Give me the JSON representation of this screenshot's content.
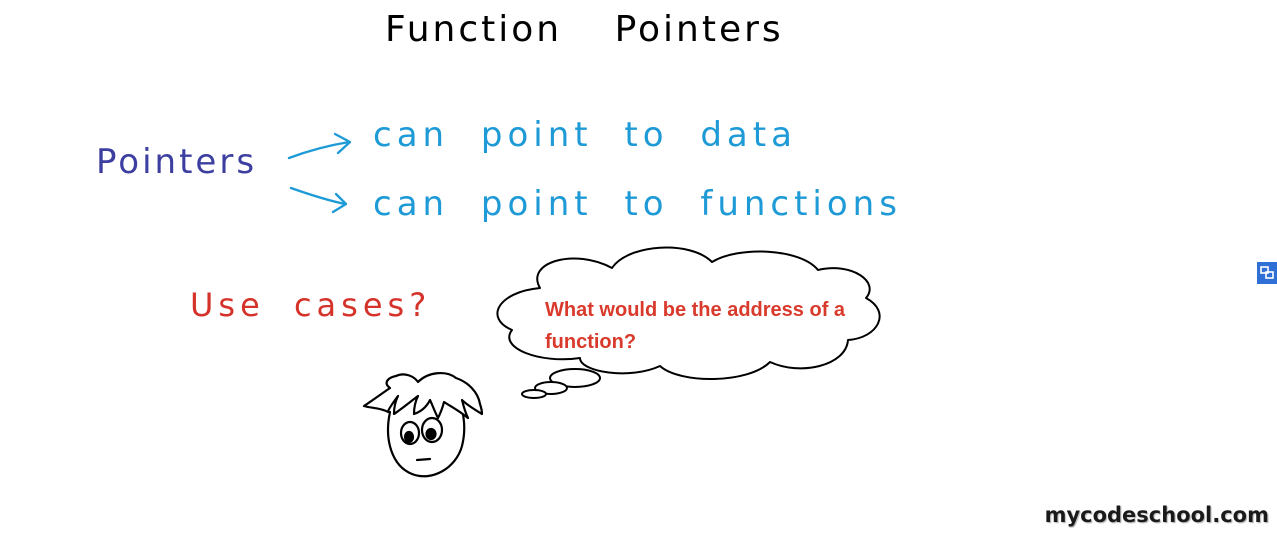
{
  "title": "Function    Pointers",
  "pointers_word": "Pointers",
  "branches": [
    {
      "text": "can point to data"
    },
    {
      "text": "can point to functions"
    }
  ],
  "use_cases": "Use cases?",
  "thought_bubble": {
    "text": "What would be the address of a function?"
  },
  "watermark": "mycodeschool.com",
  "colors": {
    "title": "#000000",
    "pointers": "#3c3fa0",
    "branches": "#1e9ad6",
    "use_cases": "#d5322a",
    "bubble_text": "#d93a2b",
    "outline": "#000000",
    "expand_button": "#2f6fd6"
  },
  "icons": {
    "expand_button": "expand-icon",
    "character": "cartoon-face"
  }
}
